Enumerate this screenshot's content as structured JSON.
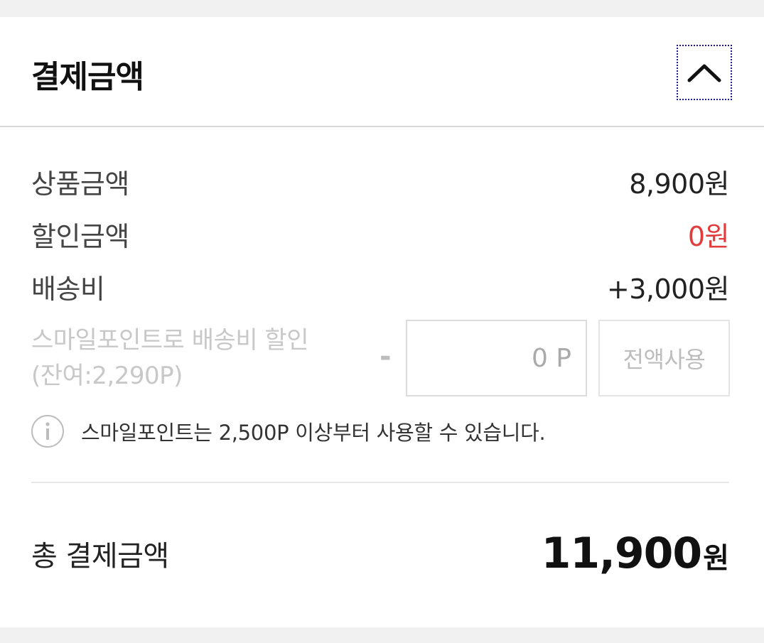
{
  "header": {
    "title": "결제금액",
    "toggle_icon": "chevron-up-icon"
  },
  "summary": {
    "product_label": "상품금액",
    "product_value": "8,900원",
    "discount_label": "할인금액",
    "discount_value": "0원",
    "shipping_label": "배송비",
    "shipping_value": "+3,000원"
  },
  "points": {
    "label_line1": "스마일포인트로 배송비 할인",
    "label_line2": "(잔여:2,290P)",
    "minus": "-",
    "input_placeholder": "0 P",
    "use_all_label": "전액사용",
    "notice": "스마일포인트는 2,500P 이상부터 사용할 수 있습니다."
  },
  "total": {
    "label": "총 결제금액",
    "amount": "11,900",
    "unit": "원"
  },
  "colors": {
    "discount_red": "#e23b3b",
    "focus_outline": "#1a1a8c"
  }
}
